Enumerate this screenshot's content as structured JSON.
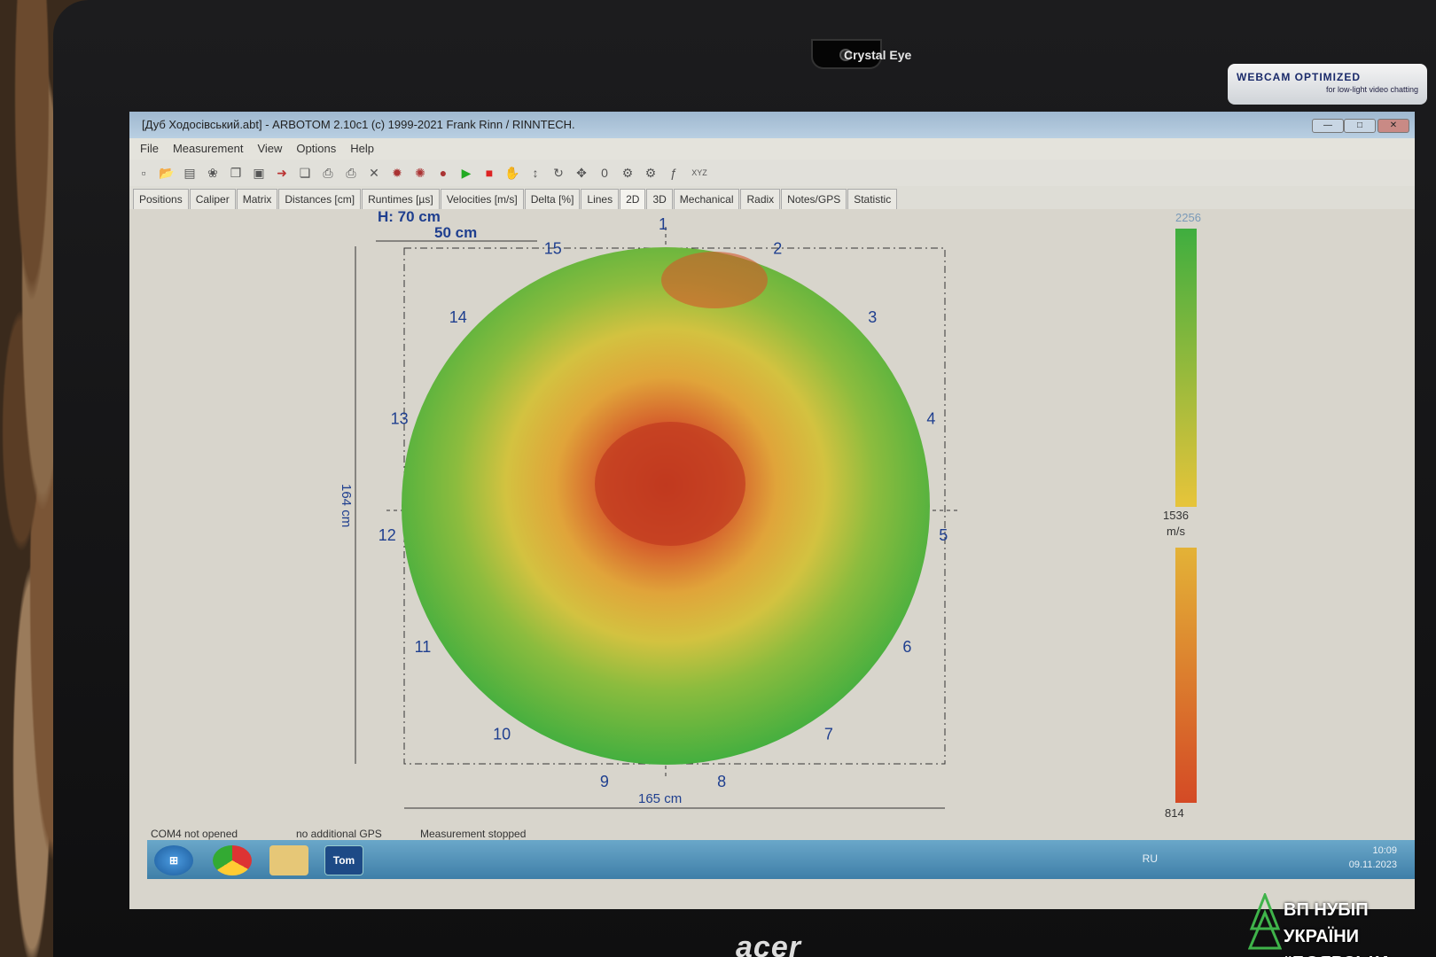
{
  "bezel": {
    "camera_label": "Crystal Eye",
    "sticker_title": "WEBCAM OPTIMIZED",
    "sticker_sub": "for low-light video chatting",
    "brand": "acer"
  },
  "watermark": {
    "line1": "ВП НУБІП УКРАЇНИ",
    "line2": "“БОЯРСЬКА ЛДС”"
  },
  "window": {
    "title": "[Дуб Ходосівський.abt] - ARBOTOM 2.10c1 (c) 1999-2021 Frank Rinn / RINNTECH.",
    "menu": [
      "File",
      "Measurement",
      "View",
      "Options",
      "Help"
    ],
    "tabs": [
      "Positions",
      "Caliper",
      "Matrix",
      "Distances [cm]",
      "Runtimes [µs]",
      "Velocities [m/s]",
      "Delta [%]",
      "Lines",
      "2D",
      "3D",
      "Mechanical",
      "Radix",
      "Notes/GPS",
      "Statistic"
    ],
    "active_tab": "2D",
    "toolbar_counter": "0",
    "toolbar_xyz": "XYZ"
  },
  "tomogram": {
    "height_label": "H: 70 cm",
    "scale_bar": "50 cm",
    "width_dim": "165 cm",
    "depth_dim": "164 cm",
    "sensors": [
      "1",
      "2",
      "3",
      "4",
      "5",
      "6",
      "7",
      "8",
      "9",
      "10",
      "11",
      "12",
      "13",
      "14",
      "15"
    ],
    "colorbar": {
      "max": "2256",
      "mid": "1536",
      "unit": "m/s",
      "min": "814",
      "colors": [
        "#3fae3f",
        "#e6c43a",
        "#d44a25"
      ]
    }
  },
  "status": {
    "com": "COM4 not opened",
    "gps": "no additional GPS",
    "measurement": "Measurement stopped"
  },
  "taskbar": {
    "app_label": "Tom",
    "lang": "RU",
    "time": "10:09",
    "date": "09.11.2023"
  }
}
